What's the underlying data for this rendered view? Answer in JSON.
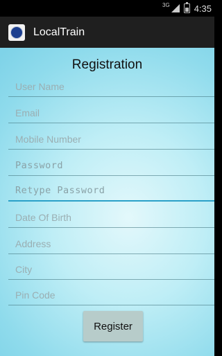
{
  "status_bar": {
    "network_label": "3G",
    "time": "4:35",
    "icons": [
      "signal-icon",
      "battery-icon"
    ]
  },
  "action_bar": {
    "app_icon": "irctc-logo-icon",
    "app_title": "LocalTrain"
  },
  "form": {
    "title": "Registration",
    "fields": [
      {
        "placeholder": "User Name",
        "value": ""
      },
      {
        "placeholder": "Email",
        "value": ""
      },
      {
        "placeholder": "Mobile Number",
        "value": ""
      },
      {
        "placeholder": "Password",
        "value": ""
      },
      {
        "placeholder": "Retype Password",
        "value": ""
      },
      {
        "placeholder": "Date Of Birth",
        "value": ""
      },
      {
        "placeholder": "Address",
        "value": ""
      },
      {
        "placeholder": "City",
        "value": ""
      },
      {
        "placeholder": "Pin Code",
        "value": ""
      }
    ],
    "submit_label": "Register"
  },
  "colors": {
    "action_bar": "#1f1f1f",
    "focus_underline": "#2aa0c8",
    "button_bg": "#b7ccca"
  }
}
